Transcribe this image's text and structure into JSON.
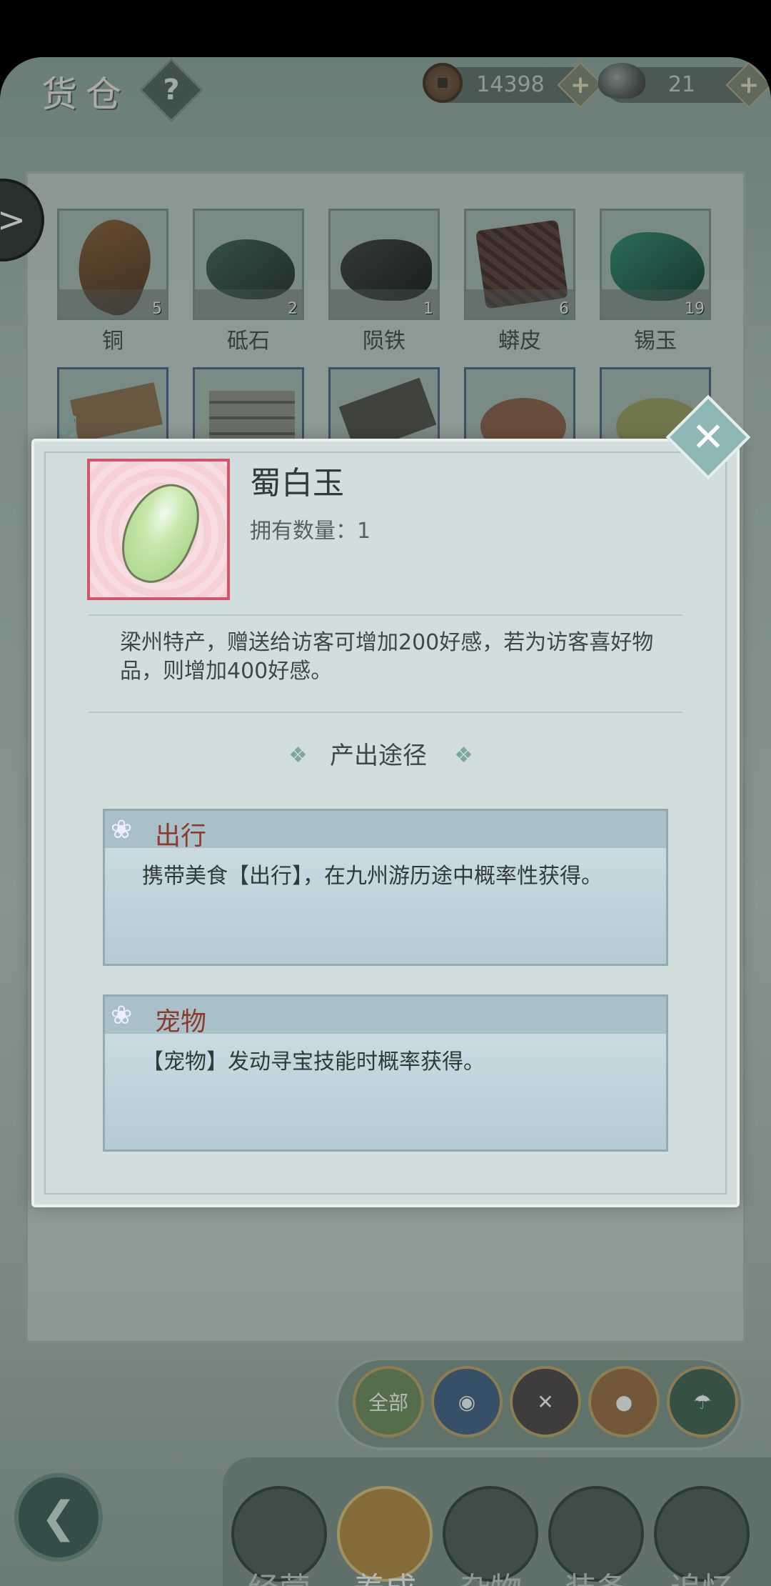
{
  "header": {
    "title": "货仓",
    "help_label": "?",
    "copper_coins": "14398",
    "silver": "21",
    "plus_label": "+"
  },
  "side_arrow_label": ">",
  "warehouse": {
    "row1": [
      {
        "name": "铜",
        "count": "5"
      },
      {
        "name": "砥石",
        "count": "2"
      },
      {
        "name": "陨铁",
        "count": "1"
      },
      {
        "name": "蟒皮",
        "count": "6"
      },
      {
        "name": "锡玉",
        "count": "19"
      }
    ]
  },
  "popup": {
    "item_name": "蜀白玉",
    "quantity_label": "拥有数量：1",
    "description": "梁州特产，赠送给访客可增加200好感，若为访客喜好物品，则增加400好感。",
    "source_header": "产出途径",
    "diamond": "❖",
    "close": "✕",
    "lotus": "❀",
    "sources": [
      {
        "title": "出行",
        "desc": "携带美食【出行】，在九州游历途中概率性获得。"
      },
      {
        "title": "宠物",
        "desc": "【宠物】发动寻宝技能时概率获得。"
      }
    ]
  },
  "filters": {
    "all_label": "全部"
  },
  "back_label": "❮",
  "nav": {
    "items": [
      {
        "label": "经营"
      },
      {
        "label": "养成"
      },
      {
        "label": "杂物"
      },
      {
        "label": "装备"
      },
      {
        "label": "追忆"
      }
    ]
  },
  "colors": {
    "accent_red": "#8d3b2c",
    "popup_bg": "#d2dedd",
    "icon_border": "#d2566a"
  }
}
